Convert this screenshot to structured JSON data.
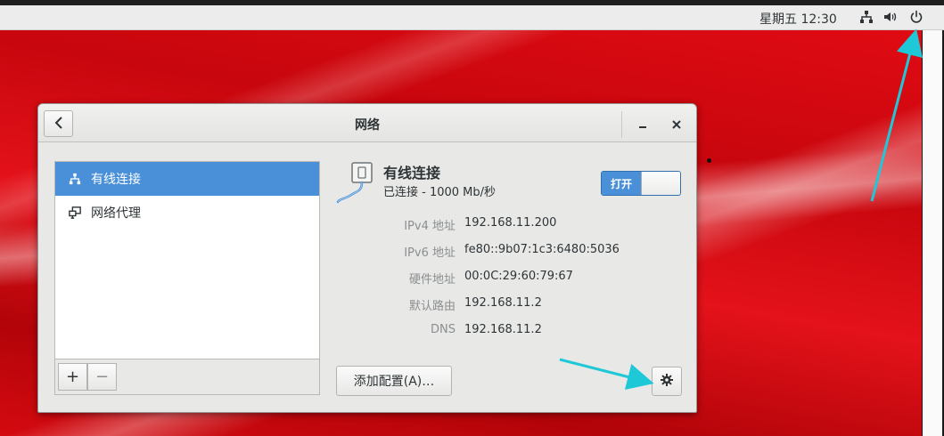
{
  "topbar": {
    "clock": "星期五 12:30",
    "icons": [
      "network-icon",
      "volume-icon",
      "power-icon"
    ]
  },
  "window": {
    "title": "网络",
    "devices": [
      {
        "label": "有线连接",
        "icon": "wired-network-icon",
        "selected": true
      },
      {
        "label": "网络代理",
        "icon": "network-proxy-icon",
        "selected": false
      }
    ],
    "list_add": "+",
    "list_remove": "−",
    "connection": {
      "name": "有线连接",
      "status": "已连接 - 1000 Mb/秒",
      "toggle_label": "打开",
      "toggle_on": true
    },
    "details": [
      {
        "label": "IPv4 地址",
        "value": "192.168.11.200"
      },
      {
        "label": "IPv6 地址",
        "value": "fe80::9b07:1c3:6480:5036"
      },
      {
        "label": "硬件地址",
        "value": "00:0C:29:60:79:67"
      },
      {
        "label": "默认路由",
        "value": "192.168.11.2"
      },
      {
        "label": "DNS",
        "value": "192.168.11.2"
      }
    ],
    "add_profile_label": "添加配置(A)…"
  },
  "colors": {
    "accent": "#4a90d9",
    "arrow": "#1fc8d6",
    "desktop": "#d40a10"
  }
}
